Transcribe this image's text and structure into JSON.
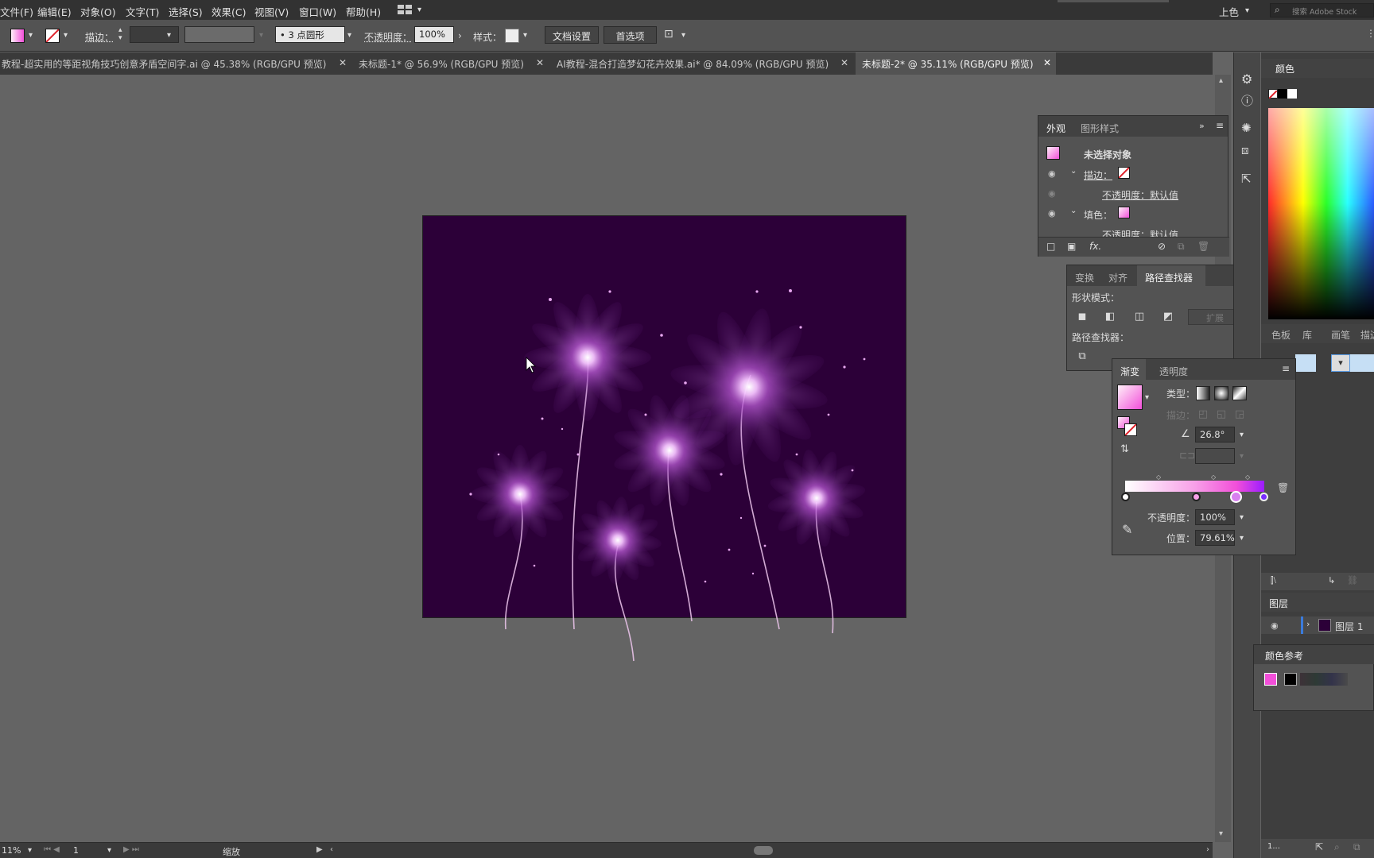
{
  "menu": [
    "文件(F)",
    "编辑(E)",
    "对象(O)",
    "文字(T)",
    "选择(S)",
    "效果(C)",
    "视图(V)",
    "窗口(W)",
    "帮助(H)"
  ],
  "menu_right": {
    "workspace": "上色",
    "search_placeholder": "搜索 Adobe Stock"
  },
  "control": {
    "stroke_label": "描边：",
    "brush": "3 点圆形",
    "opacity_label": "不透明度：",
    "opacity_value": "100%",
    "style_label": "样式：",
    "doc_setup": "文档设置",
    "prefs": "首选项"
  },
  "tabs": [
    {
      "label": "教程-超实用的等距视角技巧创意矛盾空间字.ai @ 45.38% (RGB/GPU 预览)",
      "active": false
    },
    {
      "label": "未标题-1* @ 56.9% (RGB/GPU 预览)",
      "active": false
    },
    {
      "label": "AI教程-混合打造梦幻花卉效果.ai* @ 84.09% (RGB/GPU 预览)",
      "active": false
    },
    {
      "label": "未标题-2* @ 35.11% (RGB/GPU 预览)",
      "active": true
    }
  ],
  "appearance": {
    "tabs": [
      "外观",
      "图形样式"
    ],
    "title": "未选择对象",
    "stroke_label": "描边：",
    "stroke_opacity": "不透明度：默认值",
    "fill_label": "填色：",
    "fill_opacity": "不透明度：默认值",
    "fx": "fx."
  },
  "pathfinder": {
    "tabs": [
      "变换",
      "对齐",
      "路径查找器"
    ],
    "shape_modes": "形状模式：",
    "expand": "扩展",
    "pathfinders": "路径查找器："
  },
  "gradient": {
    "tabs": [
      "渐变",
      "透明度"
    ],
    "type_label": "类型：",
    "stroke_label": "描边：",
    "angle": "26.8°",
    "opacity_label": "不透明度：",
    "opacity_value": "100%",
    "position_label": "位置：",
    "position_value": "79.61%"
  },
  "color_panel": {
    "title": "颜色"
  },
  "swatches_tabs": [
    "色板",
    "库",
    "画笔",
    "描边"
  ],
  "layers": {
    "title": "图层",
    "layer_name": "图层 1",
    "footer": "1..."
  },
  "color_guide": {
    "title": "颜色参考"
  },
  "status": {
    "zoom": "11%",
    "artboard": "1",
    "mode": "缩放"
  },
  "colors": {
    "artboard": "#2c0038",
    "accent_pink": "#f24fd9",
    "gradient_end": "#9b1cff"
  }
}
